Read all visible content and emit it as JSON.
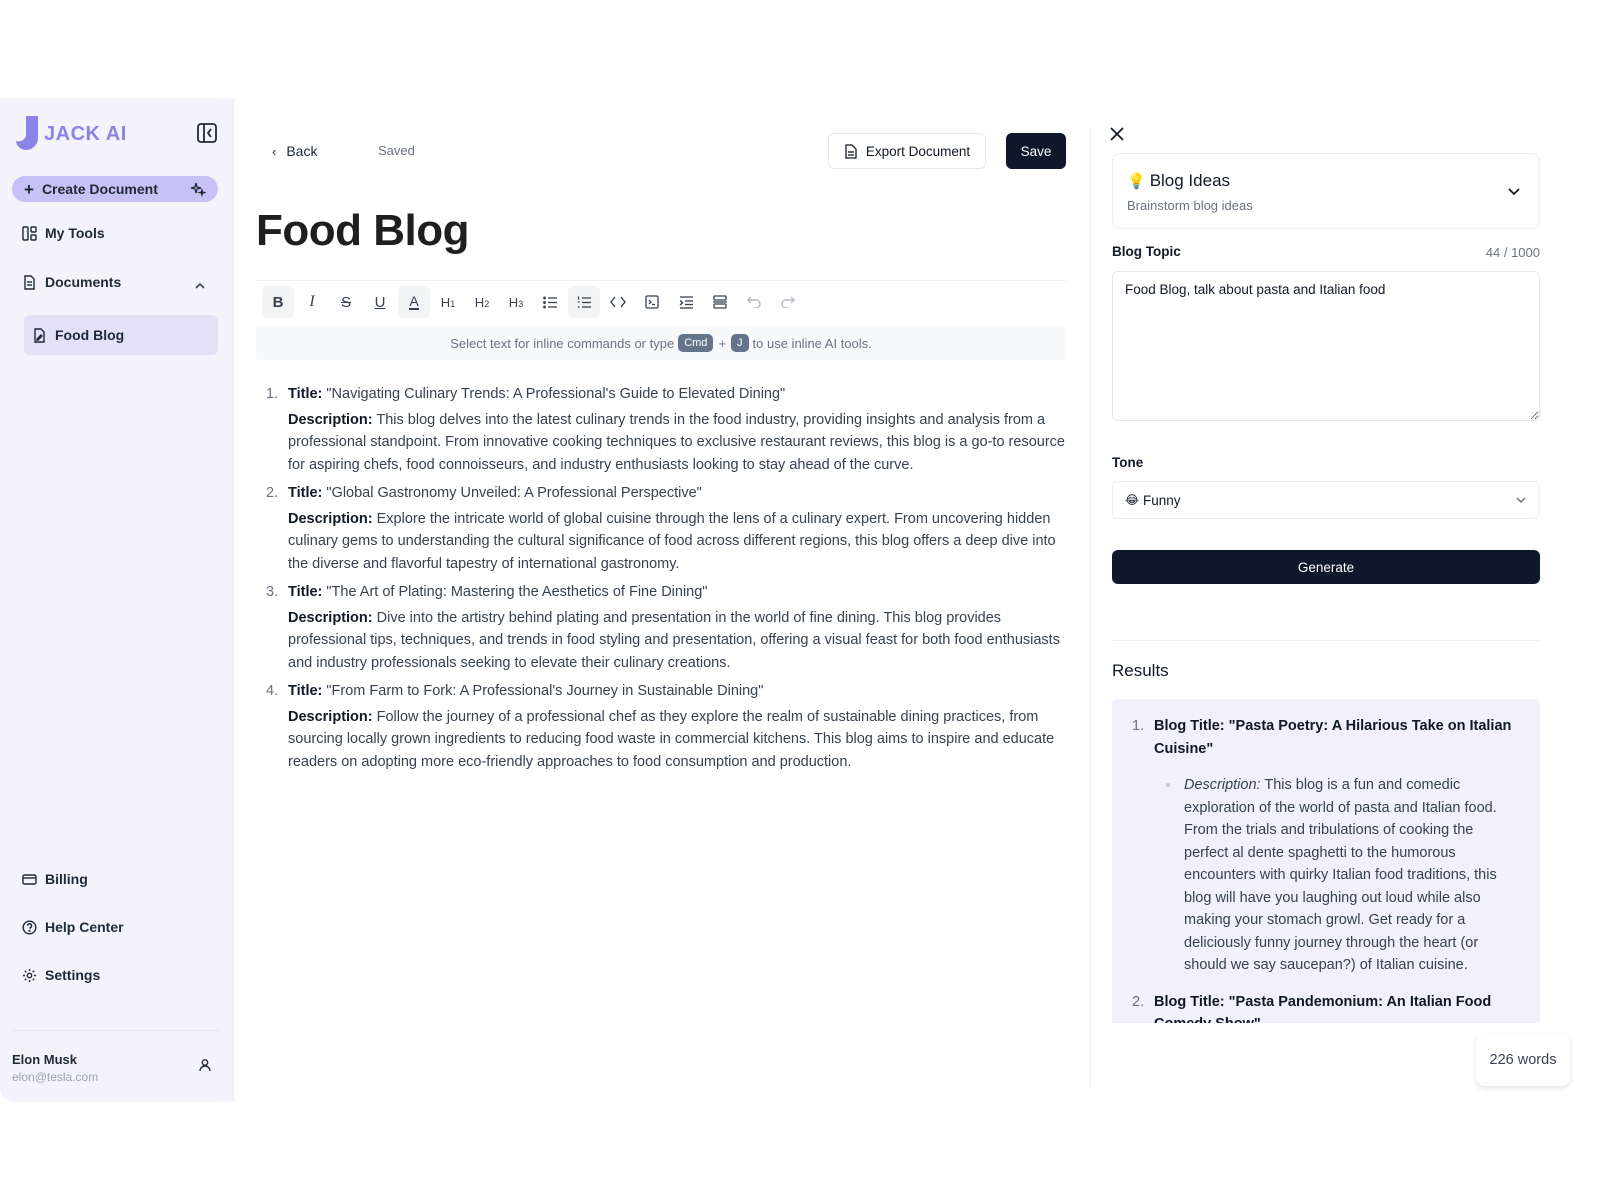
{
  "brand": {
    "name": "JACK AI",
    "accent": "#8b84e6"
  },
  "sidebar": {
    "create_label": "Create Document",
    "my_tools": "My Tools",
    "documents": "Documents",
    "active_document": "Food Blog",
    "billing": "Billing",
    "help_center": "Help Center",
    "settings": "Settings",
    "user": {
      "name": "Elon Musk",
      "email": "elon@tesla.com"
    }
  },
  "header": {
    "back_label": "Back",
    "status": "Saved",
    "export_label": "Export Document",
    "save_label": "Save"
  },
  "document": {
    "title": "Food Blog",
    "hint": {
      "before": "Select text for inline commands or type",
      "key1": "Cmd",
      "plus": "+",
      "key2": "J",
      "after": "to use inline AI tools."
    },
    "title_label": "Title:",
    "description_label": "Description:",
    "items": [
      {
        "num": "1.",
        "title": "\"Navigating Culinary Trends: A Professional's Guide to Elevated Dining\"",
        "description": "This blog delves into the latest culinary trends in the food industry, providing insights and analysis from a professional standpoint. From innovative cooking techniques to exclusive restaurant reviews, this blog is a go-to resource for aspiring chefs, food connoisseurs, and industry enthusiasts looking to stay ahead of the curve."
      },
      {
        "num": "2.",
        "title": "\"Global Gastronomy Unveiled: A Professional Perspective\"",
        "description": "Explore the intricate world of global cuisine through the lens of a culinary expert. From uncovering hidden culinary gems to understanding the cultural significance of food across different regions, this blog offers a deep dive into the diverse and flavorful tapestry of international gastronomy."
      },
      {
        "num": "3.",
        "title": "\"The Art of Plating: Mastering the Aesthetics of Fine Dining\"",
        "description": "Dive into the artistry behind plating and presentation in the world of fine dining. This blog provides professional tips, techniques, and trends in food styling and presentation, offering a visual feast for both food enthusiasts and industry professionals seeking to elevate their culinary creations."
      },
      {
        "num": "4.",
        "title": "\"From Farm to Fork: A Professional's Journey in Sustainable Dining\"",
        "description": "Follow the journey of a professional chef as they explore the realm of sustainable dining practices, from sourcing locally grown ingredients to reducing food waste in commercial kitchens. This blog aims to inspire and educate readers on adopting more eco-friendly approaches to food consumption and production."
      }
    ],
    "word_count": "226 words"
  },
  "panel": {
    "tool": {
      "name": "Blog Ideas",
      "subtitle": "Brainstorm blog ideas"
    },
    "topic_label": "Blog Topic",
    "topic_count": "44 / 1000",
    "topic_value": "Food Blog, talk about pasta and Italian food",
    "tone_label": "Tone",
    "tone_value": "Funny",
    "generate_label": "Generate",
    "results_heading": "Results",
    "results": [
      {
        "num": "1.",
        "title": "Blog Title: \"Pasta Poetry: A Hilarious Take on Italian Cuisine\"",
        "desc_label": "Description:",
        "description": "This blog is a fun and comedic exploration of the world of pasta and Italian food. From the trials and tribulations of cooking the perfect al dente spaghetti to the humorous encounters with quirky Italian food traditions, this blog will have you laughing out loud while also making your stomach growl. Get ready for a deliciously funny journey through the heart (or should we say saucepan?) of Italian cuisine."
      },
      {
        "num": "2.",
        "title": "Blog Title: \"Pasta Pandemonium: An Italian Food Comedy Show\""
      }
    ]
  }
}
